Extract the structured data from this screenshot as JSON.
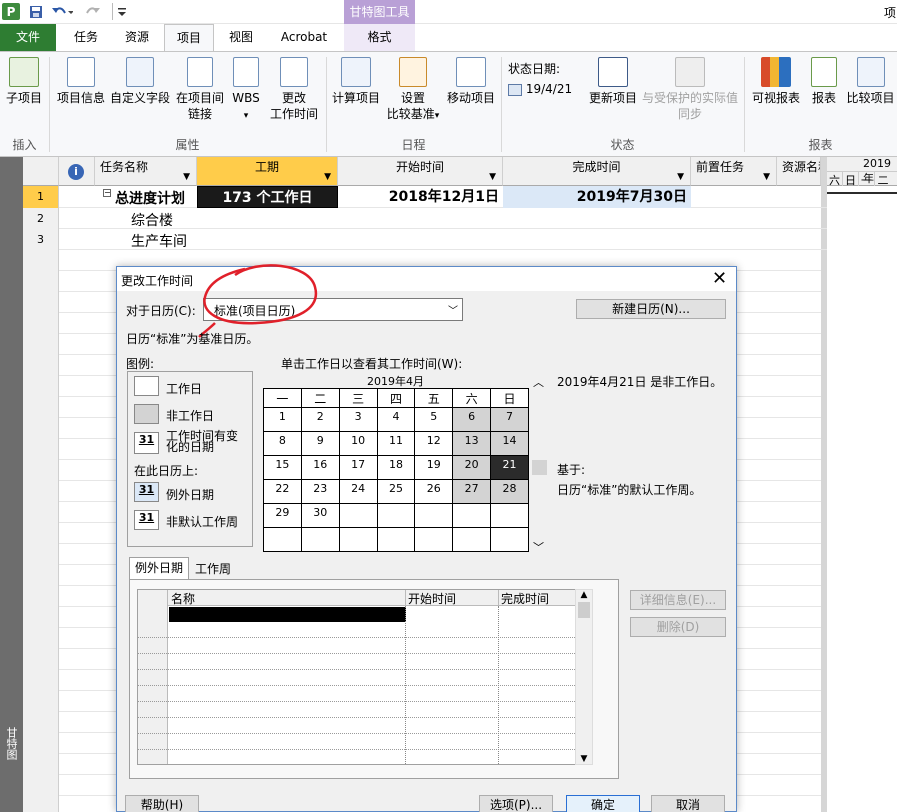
{
  "qat": {
    "save_icon": "save-icon",
    "undo_icon": "undo-icon",
    "redo_icon": "redo-icon",
    "customize_icon": "customize-qat-icon",
    "title_right": "项"
  },
  "tabs": {
    "file": "文件",
    "task": "任务",
    "resource": "资源",
    "project": "项目",
    "view": "视图",
    "acrobat": "Acrobat",
    "contextual_header": "甘特图工具",
    "format": "格式"
  },
  "ribbon": {
    "subproject": "子项目",
    "project_info": "项目信息",
    "custom_fields": "自定义字段",
    "links_line1": "在项目间",
    "links_line2": "链接",
    "wbs": "WBS",
    "change_worktime_line1": "更改",
    "change_worktime_line2": "工作时间",
    "calc_project": "计算项目",
    "set_baseline_line1": "设置",
    "set_baseline_line2": "比较基准",
    "move_project": "移动项目",
    "status_date_label": "状态日期:",
    "status_date_value": "19/4/21",
    "update_project": "更新项目",
    "update_protected_line1": "与受保护的实际值",
    "update_protected_line2": "同步",
    "visual_reports": "可视报表",
    "reports": "报表",
    "compare_projects": "比较项目",
    "group_insert": "插入",
    "group_properties": "属性",
    "group_schedule": "日程",
    "group_status": "状态",
    "group_reports": "报表"
  },
  "grid": {
    "headers": {
      "task_name": "任务名称",
      "duration": "工期",
      "start": "开始时间",
      "finish": "完成时间",
      "predecessors": "前置任务",
      "resources": "资源名称"
    },
    "timescale_top": "2019年",
    "timescale_days": [
      "六",
      "日",
      "一",
      "二"
    ],
    "rows": [
      {
        "id": "1",
        "name": "总进度计划",
        "duration": "173 个工作日",
        "start": "2018年12月1日",
        "finish": "2019年7月30日"
      },
      {
        "id": "2",
        "name": "综合楼",
        "duration": "",
        "start": "",
        "finish": ""
      },
      {
        "id": "3",
        "name": "生产车间",
        "duration": "",
        "start": "",
        "finish": ""
      }
    ],
    "side_label": "甘特图"
  },
  "dialog": {
    "title": "更改工作时间",
    "calendar_for_label": "对于日历(C):",
    "calendar_value": "标准(项目日历)",
    "new_calendar": "新建日历(N)...",
    "base_note": "日历“标准”为基准日历。",
    "legend_title": "图例:",
    "legend_working": "工作日",
    "legend_nonworking": "非工作日",
    "legend_edited_line1": "工作时间有变",
    "legend_edited_line2": "化的日期",
    "legend_on_this": "在此日历上:",
    "legend_exception": "例外日期",
    "legend_nondefault": "非默认工作周",
    "legend_31": "31",
    "click_hint": "单击工作日以查看其工作时间(W):",
    "month": "2019年4月",
    "weekdays": [
      "一",
      "二",
      "三",
      "四",
      "五",
      "六",
      "日"
    ],
    "weeks": [
      [
        "1",
        "2",
        "3",
        "4",
        "5",
        "6",
        "7"
      ],
      [
        "8",
        "9",
        "10",
        "11",
        "12",
        "13",
        "14"
      ],
      [
        "15",
        "16",
        "17",
        "18",
        "19",
        "20",
        "21"
      ],
      [
        "22",
        "23",
        "24",
        "25",
        "26",
        "27",
        "28"
      ],
      [
        "29",
        "30",
        "",
        "",
        "",
        "",
        ""
      ],
      [
        "",
        "",
        "",
        "",
        "",
        "",
        ""
      ]
    ],
    "info_line": "2019年4月21日 是非工作日。",
    "based_on": "基于:",
    "based_on_detail": "日历“标准”的默认工作周。",
    "tab_exceptions": "例外日期",
    "tab_workweeks": "工作周",
    "ex_col_name": "名称",
    "ex_col_start": "开始时间",
    "ex_col_finish": "完成时间",
    "details_btn": "详细信息(E)...",
    "delete_btn": "删除(D)",
    "help_btn": "帮助(H)",
    "options_btn": "选项(P)...",
    "ok_btn": "确定",
    "cancel_btn": "取消"
  },
  "colors": {
    "file_tab": "#2e7d32",
    "contextual": "#b9a0d6",
    "annotation": "#e0202a",
    "selected_cell": "#2b2b2b"
  }
}
